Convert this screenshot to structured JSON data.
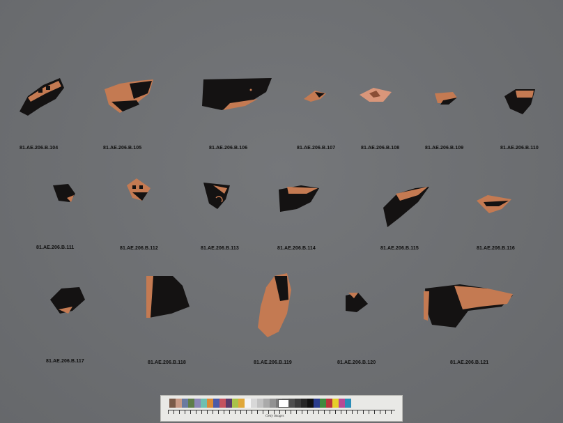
{
  "labels": {
    "b104": "81.AE.206.B.104",
    "b105": "81.AE.206.B.105",
    "b106": "81.AE.206.B.106",
    "b107": "81.AE.206.B.107",
    "b108": "81.AE.206.B.108",
    "b109": "81.AE.206.B.109",
    "b110": "81.AE.206.B.110",
    "b111": "81.AE.206.B.111",
    "b112": "81.AE.206.B.112",
    "b113": "81.AE.206.B.113",
    "b114": "81.AE.206.B.114",
    "b115": "81.AE.206.B.115",
    "b116": "81.AE.206.B.116",
    "b117": "81.AE.206.B.117",
    "b118": "81.AE.206.B.118",
    "b119": "81.AE.206.B.119",
    "b120": "81.AE.206.B.120",
    "b121": "81.AE.206.B.121"
  },
  "colors": {
    "background": "#6e7073",
    "glaze": "#141212",
    "clay": "#c47a52",
    "clay_light": "#d9967a"
  },
  "calibration_card": {
    "swatch_colors": [
      "#7a5a48",
      "#c89a86",
      "#6a7aa0",
      "#5e7d4a",
      "#8b87b6",
      "#6fbfb0",
      "#d98a36",
      "#4a5aa8",
      "#c5525f",
      "#5b3a6a",
      "#a9c24a",
      "#e0a83a",
      "#f4f4f4",
      "#d8d8d8",
      "#c2c2c2",
      "#aaaaaa",
      "#929292",
      "#7a7a7a",
      "#636363",
      "#4e4e4e",
      "#3a3a3a",
      "#262626",
      "#111111",
      "#2a3c8c",
      "#3f8a3f",
      "#b8353b",
      "#e6cf2a",
      "#b84a94",
      "#2b8db8"
    ],
    "logo_text": "Getty Images"
  }
}
